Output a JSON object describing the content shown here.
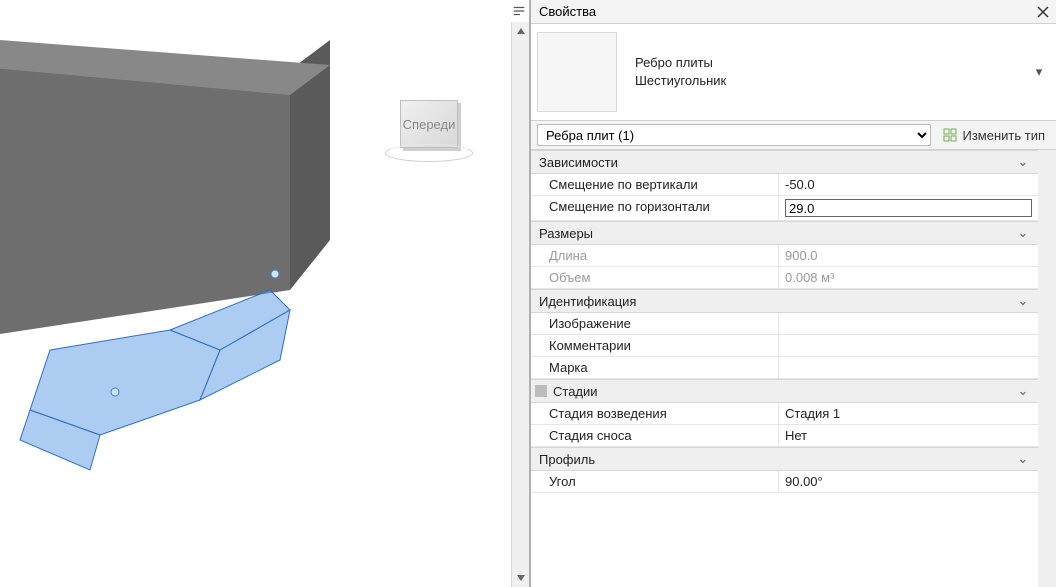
{
  "viewcube": {
    "face": "Спереди"
  },
  "palette": {
    "title": "Свойства",
    "type": {
      "family": "Ребро плиты",
      "name": "Шестиугольник"
    },
    "selector": "Ребра плит (1)",
    "editType": "Изменить тип",
    "groups": [
      {
        "label": "Зависимости",
        "rows": [
          {
            "key": "Смещение по вертикали",
            "value": "-50.0",
            "editable": true,
            "active": false
          },
          {
            "key": "Смещение по горизонтали",
            "value": "29.0",
            "editable": true,
            "active": true
          }
        ]
      },
      {
        "label": "Размеры",
        "rows": [
          {
            "key": "Длина",
            "value": "900.0",
            "readonly": true
          },
          {
            "key": "Объем",
            "value": "0.008 м³",
            "readonly": true
          }
        ]
      },
      {
        "label": "Идентификация",
        "rows": [
          {
            "key": "Изображение",
            "value": ""
          },
          {
            "key": "Комментарии",
            "value": ""
          },
          {
            "key": "Марка",
            "value": ""
          }
        ]
      },
      {
        "label": "Стадии",
        "hasBlock": true,
        "rows": [
          {
            "key": "Стадия возведения",
            "value": "Стадия 1"
          },
          {
            "key": "Стадия сноса",
            "value": "Нет"
          }
        ]
      },
      {
        "label": "Профиль",
        "rows": [
          {
            "key": "Угол",
            "value": "90.00°"
          }
        ]
      }
    ]
  }
}
